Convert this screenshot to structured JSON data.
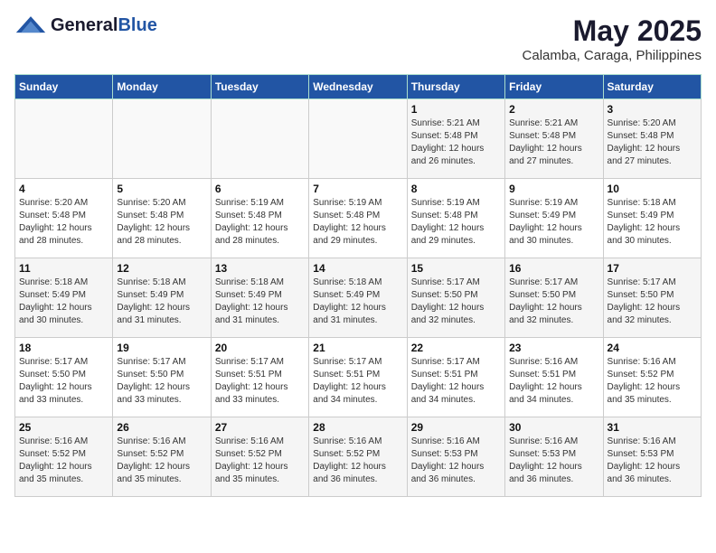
{
  "header": {
    "logo_general": "General",
    "logo_blue": "Blue",
    "month_title": "May 2025",
    "location": "Calamba, Caraga, Philippines"
  },
  "weekdays": [
    "Sunday",
    "Monday",
    "Tuesday",
    "Wednesday",
    "Thursday",
    "Friday",
    "Saturday"
  ],
  "weeks": [
    [
      {
        "day": "",
        "info": ""
      },
      {
        "day": "",
        "info": ""
      },
      {
        "day": "",
        "info": ""
      },
      {
        "day": "",
        "info": ""
      },
      {
        "day": "1",
        "info": "Sunrise: 5:21 AM\nSunset: 5:48 PM\nDaylight: 12 hours\nand 26 minutes."
      },
      {
        "day": "2",
        "info": "Sunrise: 5:21 AM\nSunset: 5:48 PM\nDaylight: 12 hours\nand 27 minutes."
      },
      {
        "day": "3",
        "info": "Sunrise: 5:20 AM\nSunset: 5:48 PM\nDaylight: 12 hours\nand 27 minutes."
      }
    ],
    [
      {
        "day": "4",
        "info": "Sunrise: 5:20 AM\nSunset: 5:48 PM\nDaylight: 12 hours\nand 28 minutes."
      },
      {
        "day": "5",
        "info": "Sunrise: 5:20 AM\nSunset: 5:48 PM\nDaylight: 12 hours\nand 28 minutes."
      },
      {
        "day": "6",
        "info": "Sunrise: 5:19 AM\nSunset: 5:48 PM\nDaylight: 12 hours\nand 28 minutes."
      },
      {
        "day": "7",
        "info": "Sunrise: 5:19 AM\nSunset: 5:48 PM\nDaylight: 12 hours\nand 29 minutes."
      },
      {
        "day": "8",
        "info": "Sunrise: 5:19 AM\nSunset: 5:48 PM\nDaylight: 12 hours\nand 29 minutes."
      },
      {
        "day": "9",
        "info": "Sunrise: 5:19 AM\nSunset: 5:49 PM\nDaylight: 12 hours\nand 30 minutes."
      },
      {
        "day": "10",
        "info": "Sunrise: 5:18 AM\nSunset: 5:49 PM\nDaylight: 12 hours\nand 30 minutes."
      }
    ],
    [
      {
        "day": "11",
        "info": "Sunrise: 5:18 AM\nSunset: 5:49 PM\nDaylight: 12 hours\nand 30 minutes."
      },
      {
        "day": "12",
        "info": "Sunrise: 5:18 AM\nSunset: 5:49 PM\nDaylight: 12 hours\nand 31 minutes."
      },
      {
        "day": "13",
        "info": "Sunrise: 5:18 AM\nSunset: 5:49 PM\nDaylight: 12 hours\nand 31 minutes."
      },
      {
        "day": "14",
        "info": "Sunrise: 5:18 AM\nSunset: 5:49 PM\nDaylight: 12 hours\nand 31 minutes."
      },
      {
        "day": "15",
        "info": "Sunrise: 5:17 AM\nSunset: 5:50 PM\nDaylight: 12 hours\nand 32 minutes."
      },
      {
        "day": "16",
        "info": "Sunrise: 5:17 AM\nSunset: 5:50 PM\nDaylight: 12 hours\nand 32 minutes."
      },
      {
        "day": "17",
        "info": "Sunrise: 5:17 AM\nSunset: 5:50 PM\nDaylight: 12 hours\nand 32 minutes."
      }
    ],
    [
      {
        "day": "18",
        "info": "Sunrise: 5:17 AM\nSunset: 5:50 PM\nDaylight: 12 hours\nand 33 minutes."
      },
      {
        "day": "19",
        "info": "Sunrise: 5:17 AM\nSunset: 5:50 PM\nDaylight: 12 hours\nand 33 minutes."
      },
      {
        "day": "20",
        "info": "Sunrise: 5:17 AM\nSunset: 5:51 PM\nDaylight: 12 hours\nand 33 minutes."
      },
      {
        "day": "21",
        "info": "Sunrise: 5:17 AM\nSunset: 5:51 PM\nDaylight: 12 hours\nand 34 minutes."
      },
      {
        "day": "22",
        "info": "Sunrise: 5:17 AM\nSunset: 5:51 PM\nDaylight: 12 hours\nand 34 minutes."
      },
      {
        "day": "23",
        "info": "Sunrise: 5:16 AM\nSunset: 5:51 PM\nDaylight: 12 hours\nand 34 minutes."
      },
      {
        "day": "24",
        "info": "Sunrise: 5:16 AM\nSunset: 5:52 PM\nDaylight: 12 hours\nand 35 minutes."
      }
    ],
    [
      {
        "day": "25",
        "info": "Sunrise: 5:16 AM\nSunset: 5:52 PM\nDaylight: 12 hours\nand 35 minutes."
      },
      {
        "day": "26",
        "info": "Sunrise: 5:16 AM\nSunset: 5:52 PM\nDaylight: 12 hours\nand 35 minutes."
      },
      {
        "day": "27",
        "info": "Sunrise: 5:16 AM\nSunset: 5:52 PM\nDaylight: 12 hours\nand 35 minutes."
      },
      {
        "day": "28",
        "info": "Sunrise: 5:16 AM\nSunset: 5:52 PM\nDaylight: 12 hours\nand 36 minutes."
      },
      {
        "day": "29",
        "info": "Sunrise: 5:16 AM\nSunset: 5:53 PM\nDaylight: 12 hours\nand 36 minutes."
      },
      {
        "day": "30",
        "info": "Sunrise: 5:16 AM\nSunset: 5:53 PM\nDaylight: 12 hours\nand 36 minutes."
      },
      {
        "day": "31",
        "info": "Sunrise: 5:16 AM\nSunset: 5:53 PM\nDaylight: 12 hours\nand 36 minutes."
      }
    ]
  ]
}
